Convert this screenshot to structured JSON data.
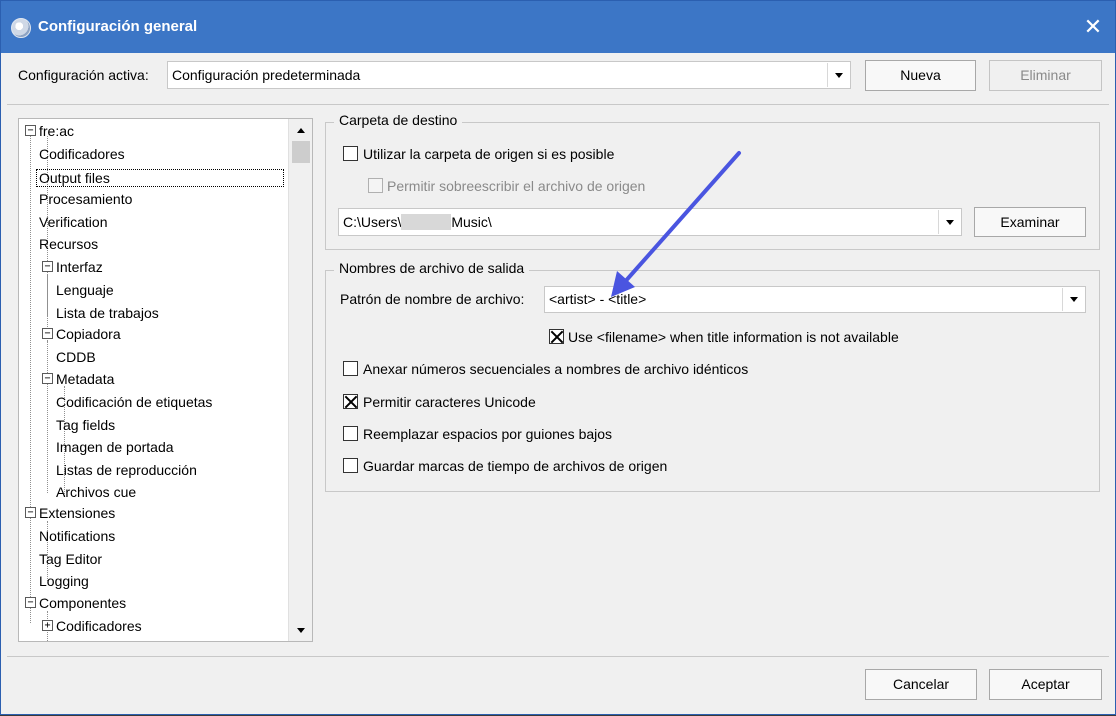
{
  "window": {
    "title": "Configuración general"
  },
  "config": {
    "active_label": "Configuración activa:",
    "active_value": "Configuración predeterminada",
    "new_button": "Nueva",
    "delete_button": "Eliminar"
  },
  "tree": {
    "items": [
      {
        "label": "fre:ac",
        "level": 0,
        "expander": "−"
      },
      {
        "label": "Codificadores",
        "level": 1
      },
      {
        "label": "Output files",
        "level": 1,
        "selected": true
      },
      {
        "label": "Procesamiento",
        "level": 1
      },
      {
        "label": "Verification",
        "level": 1
      },
      {
        "label": "Recursos",
        "level": 1
      },
      {
        "label": "Interfaz",
        "level": 1,
        "expander": "−"
      },
      {
        "label": "Lenguaje",
        "level": 2
      },
      {
        "label": "Lista de trabajos",
        "level": 2
      },
      {
        "label": "Copiadora",
        "level": 1,
        "expander": "−"
      },
      {
        "label": "CDDB",
        "level": 2
      },
      {
        "label": "Metadata",
        "level": 1,
        "expander": "−"
      },
      {
        "label": "Codificación de etiquetas",
        "level": 2
      },
      {
        "label": "Tag fields",
        "level": 2
      },
      {
        "label": "Imagen de portada",
        "level": 2
      },
      {
        "label": "Listas de reproducción",
        "level": 2
      },
      {
        "label": "Archivos cue",
        "level": 2
      },
      {
        "label": "Extensiones",
        "level": 0,
        "expander": "−"
      },
      {
        "label": "Notifications",
        "level": 1
      },
      {
        "label": "Tag Editor",
        "level": 1
      },
      {
        "label": "Logging",
        "level": 1
      },
      {
        "label": "Componentes",
        "level": 0,
        "expander": "−"
      },
      {
        "label": "Codificadores",
        "level": 1,
        "expander": "+"
      }
    ]
  },
  "destination": {
    "legend": "Carpeta de destino",
    "use_source_folder": "Utilizar la carpeta de origen si es posible",
    "allow_overwrite": "Permitir sobreescribir el archivo de origen",
    "path_prefix": "C:\\Users\\",
    "path_suffix": "Music\\",
    "browse_button": "Examinar"
  },
  "output_names": {
    "legend": "Nombres de archivo de salida",
    "pattern_label": "Patrón de nombre de archivo:",
    "pattern_value": "<artist> - <title>",
    "use_filename": "Use <filename> when title information is not available",
    "append_numbers": "Anexar números secuenciales a nombres de archivo idénticos",
    "allow_unicode": "Permitir caracteres Unicode",
    "replace_spaces": "Reemplazar espacios por guiones bajos",
    "keep_timestamps": "Guardar marcas de tiempo de archivos de origen"
  },
  "footer": {
    "cancel_button": "Cancelar",
    "accept_button": "Aceptar"
  },
  "colors": {
    "titlebar": "#3c76c6",
    "annotation_arrow": "#4a55e0"
  }
}
